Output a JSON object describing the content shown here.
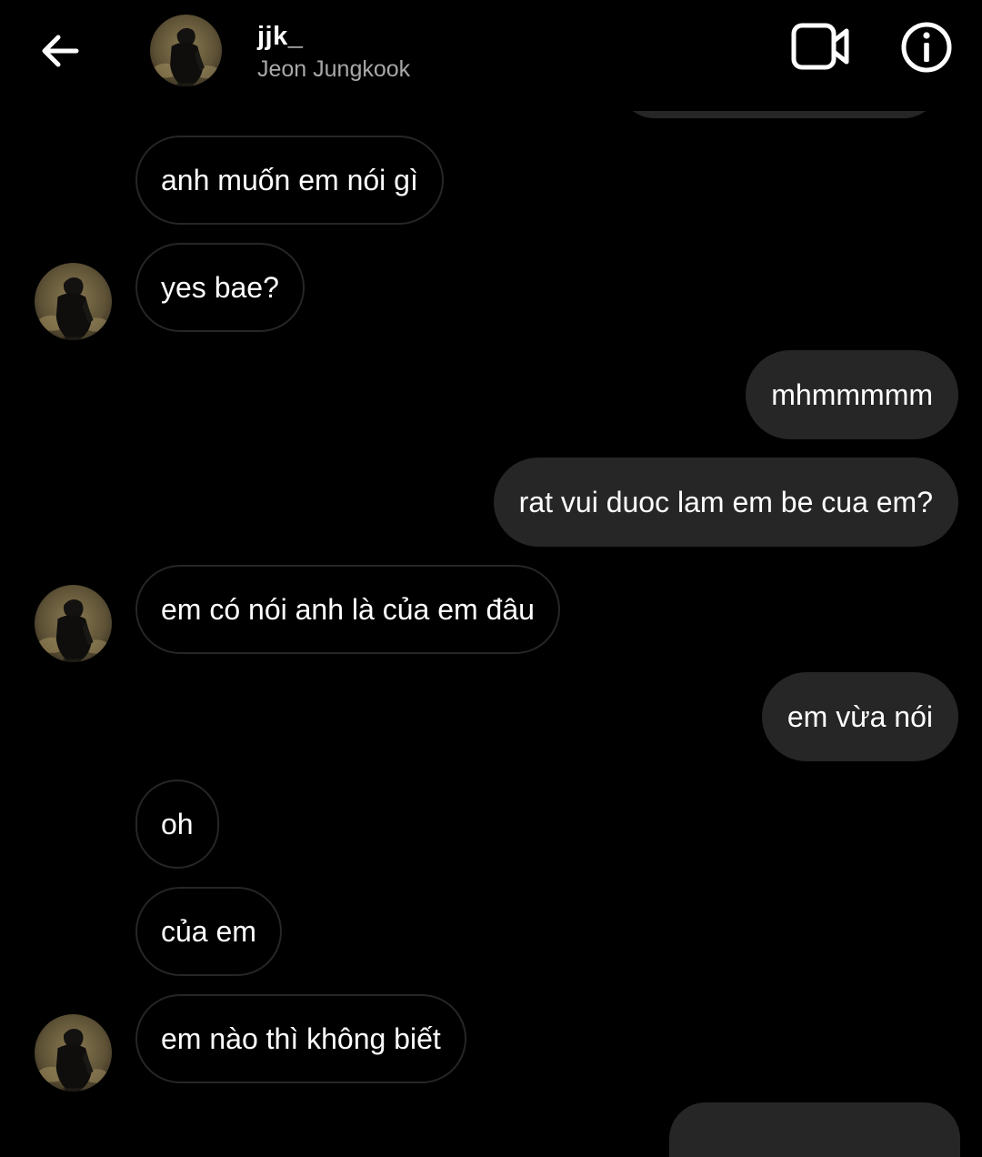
{
  "header": {
    "username": "jjk_",
    "fullname": "Jeon Jungkook",
    "back_icon": "arrow-left-icon",
    "video_icon": "video-camera-icon",
    "info_icon": "info-circle-icon"
  },
  "messages": [
    {
      "text": "anh muốn em nói gì",
      "sender": "other",
      "avatar": false
    },
    {
      "text": "yes bae?",
      "sender": "other",
      "avatar": true
    },
    {
      "text": "mhmmmmm",
      "sender": "me"
    },
    {
      "text": "rat vui duoc lam em be cua em?",
      "sender": "me"
    },
    {
      "text": "em có nói anh là của em đâu",
      "sender": "other",
      "avatar": true
    },
    {
      "text": "em vừa nói",
      "sender": "me"
    },
    {
      "text": "oh",
      "sender": "other",
      "avatar": false
    },
    {
      "text": "của em",
      "sender": "other",
      "avatar": false
    },
    {
      "text": "em nào thì không biết",
      "sender": "other",
      "avatar": true
    }
  ],
  "colors": {
    "background": "#000000",
    "sent_bubble": "#262626",
    "received_border": "#262626",
    "text": "#ffffff",
    "subtext": "#a8a8a8"
  }
}
